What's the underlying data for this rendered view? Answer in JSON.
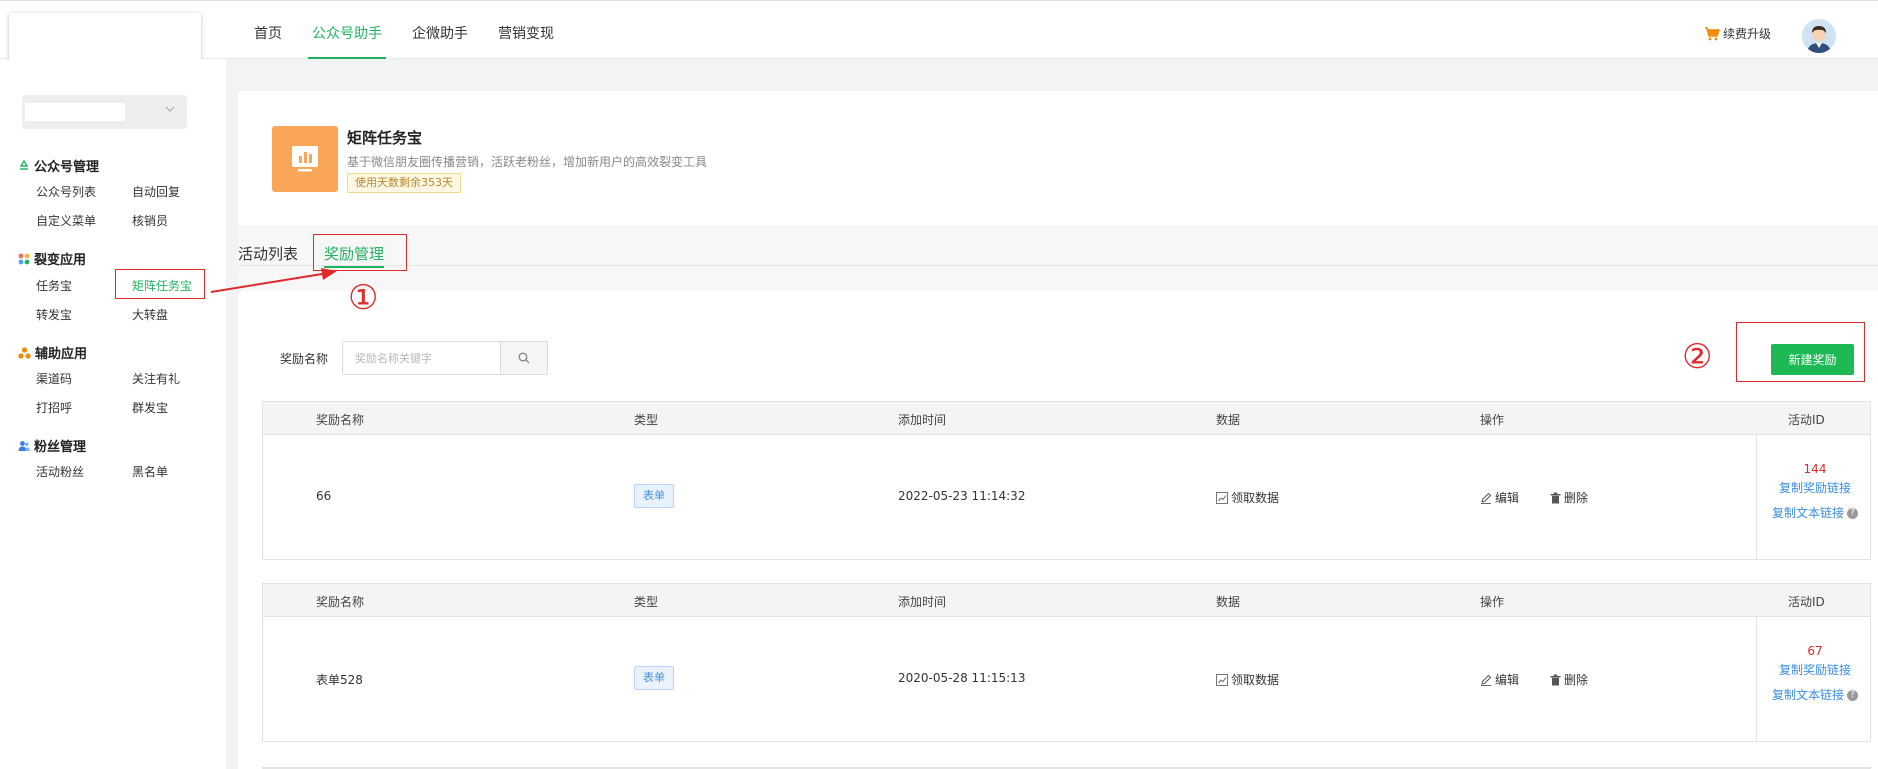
{
  "topbar": {
    "nav": [
      {
        "label": "首页"
      },
      {
        "label": "公众号助手"
      },
      {
        "label": "企微助手"
      },
      {
        "label": "营销变现"
      }
    ],
    "renew_label": "续费升级"
  },
  "sidebar": {
    "groups": [
      {
        "title": "公众号管理",
        "items": [
          "公众号列表",
          "自动回复",
          "自定义菜单",
          "核销员"
        ]
      },
      {
        "title": "裂变应用",
        "items": [
          "任务宝",
          "矩阵任务宝",
          "转发宝",
          "大转盘"
        ]
      },
      {
        "title": "辅助应用",
        "items": [
          "渠道码",
          "关注有礼",
          "打招呼",
          "群发宝"
        ]
      },
      {
        "title": "粉丝管理",
        "items": [
          "活动粉丝",
          "黑名单"
        ]
      }
    ]
  },
  "app": {
    "title": "矩阵任务宝",
    "description": "基于微信朋友圈传播营销，活跃老粉丝，增加新用户的高效裂变工具",
    "badge": "使用天数剩余353天"
  },
  "tabs": [
    {
      "label": "活动列表"
    },
    {
      "label": "奖励管理"
    }
  ],
  "annotations": {
    "step1": "①",
    "step2": "②"
  },
  "search": {
    "label": "奖励名称",
    "placeholder": "奖励名称关键字"
  },
  "new_button": "新建奖励",
  "table": {
    "columns": [
      "奖励名称",
      "类型",
      "添加时间",
      "数据",
      "操作",
      "活动ID"
    ],
    "data_link": "领取数据",
    "edit_label": "编辑",
    "delete_label": "删除",
    "copy_reward_link": "复制奖励链接",
    "copy_text_link": "复制文本链接",
    "rows": [
      {
        "name": "66",
        "type": "表单",
        "time": "2022-05-23 11:14:32",
        "id": "144"
      },
      {
        "name": "表单528",
        "type": "表单",
        "time": "2020-05-28 11:15:13",
        "id": "67"
      }
    ]
  },
  "colors": {
    "accent": "#21b360",
    "annotation": "#e02a2a",
    "link": "#3a8ee6",
    "app_icon": "#f9a658"
  }
}
